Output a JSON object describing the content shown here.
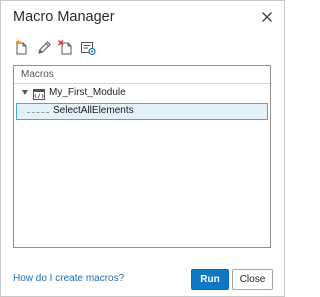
{
  "window": {
    "title": "Macro Manager",
    "close_icon": "close-icon"
  },
  "toolbar": {
    "icons": [
      "new-module-icon",
      "edit-pencil-icon",
      "delete-module-icon",
      "properties-icon"
    ],
    "accent_color": "#e8a33a",
    "icon_color": "#555555"
  },
  "panel": {
    "header": "Macros",
    "tree": {
      "module": {
        "label": "My_First_Module",
        "icon": "module-icon",
        "expanded": true
      },
      "macros": [
        {
          "label": "SelectAllElements",
          "selected": true
        }
      ]
    },
    "selection_background": "#e3f1fb",
    "selection_border": "#4aa6dc"
  },
  "footer": {
    "help_link": "How do I create macros?",
    "run_label": "Run",
    "close_label": "Close",
    "primary_color": "#0d78c6",
    "link_color": "#1a6fb5"
  }
}
